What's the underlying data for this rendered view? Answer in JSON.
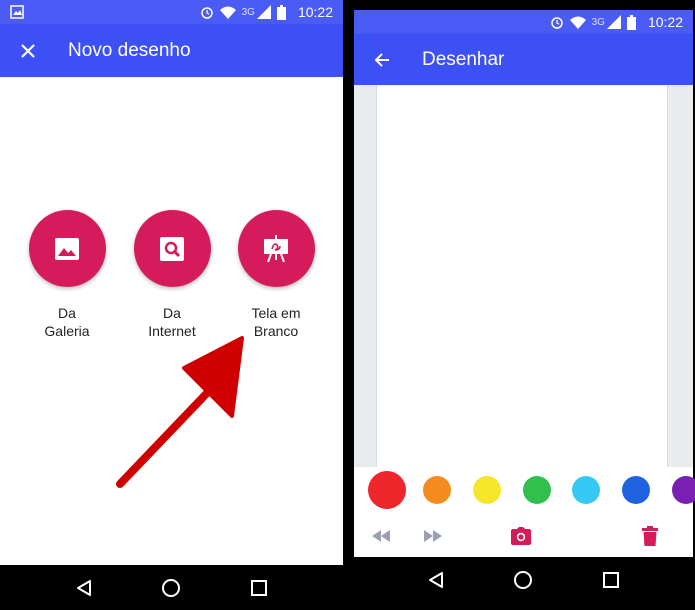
{
  "left_screen": {
    "status_bar": {
      "time": "10:22",
      "network": "3G"
    },
    "app_bar": {
      "title": "Novo desenho"
    },
    "options": [
      {
        "line1": "Da",
        "line2": "Galeria"
      },
      {
        "line1": "Da",
        "line2": "Internet"
      },
      {
        "line1": "Tela em",
        "line2": "Branco"
      }
    ],
    "colors": {
      "primary": "#3d50f5",
      "accent": "#d61b5c",
      "arrow": "#d00000"
    }
  },
  "right_screen": {
    "status_bar": {
      "time": "10:22",
      "network": "3G"
    },
    "app_bar": {
      "title": "Desenhar"
    },
    "palette": [
      "#f0262d",
      "#f58a1f",
      "#f5e62a",
      "#31bf4e",
      "#37c9f5",
      "#1f63e0",
      "#7a1fb3"
    ],
    "tools": [
      "rewind-icon",
      "fast-forward-icon",
      "camera-icon",
      "trash-icon"
    ],
    "colors": {
      "tool_accent": "#d61b5c",
      "tool_muted": "#9aa0b4"
    }
  }
}
